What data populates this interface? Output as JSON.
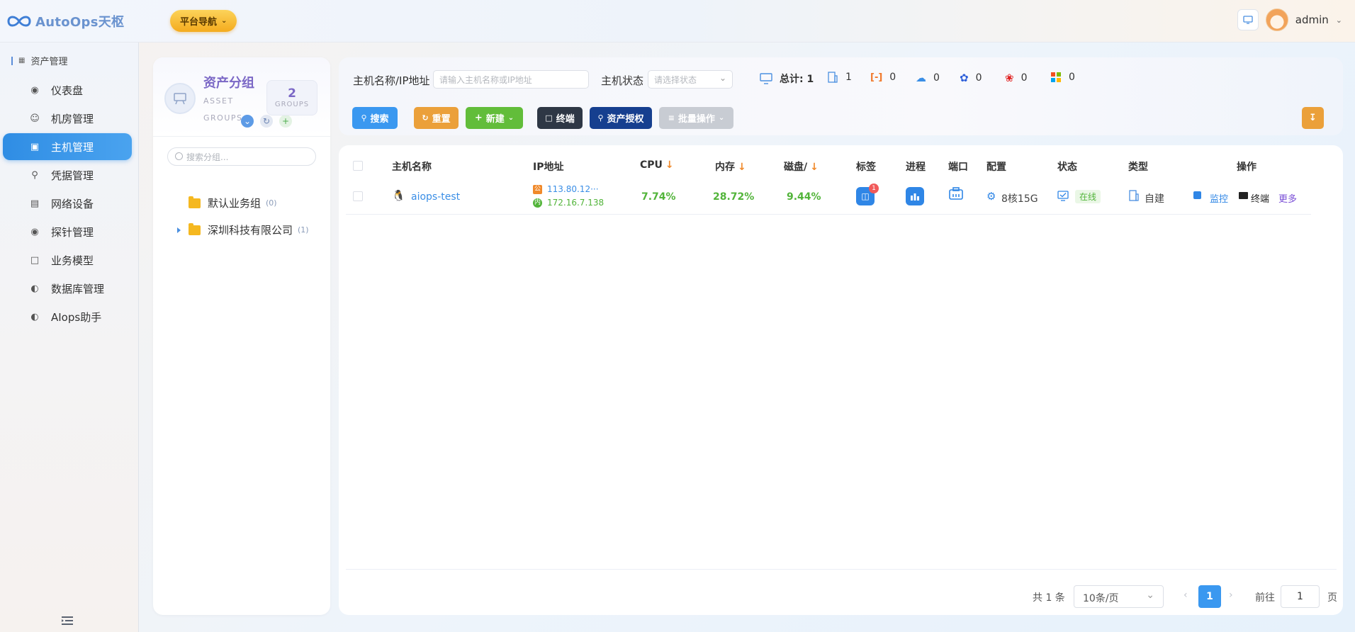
{
  "app": {
    "title": "AutoOps天枢",
    "nav_button": "平台导航",
    "user": "admin"
  },
  "colors": {
    "brand": "#2f8de4",
    "accent_orange": "#f0892a",
    "success": "#52b43a",
    "nav_gold": "#f4ab1e"
  },
  "sidebar": {
    "section": "资产管理",
    "items": [
      {
        "label": "仪表盘",
        "icon": "camera-icon"
      },
      {
        "label": "机房管理",
        "icon": "user-icon"
      },
      {
        "label": "主机管理",
        "icon": "monitor-icon",
        "active": true
      },
      {
        "label": "凭据管理",
        "icon": "key-icon"
      },
      {
        "label": "网络设备",
        "icon": "router-icon"
      },
      {
        "label": "探针管理",
        "icon": "camera-icon"
      },
      {
        "label": "业务模型",
        "icon": "folder-icon"
      },
      {
        "label": "数据库管理",
        "icon": "gauge-icon"
      },
      {
        "label": "AIops助手",
        "icon": "gauge-icon"
      }
    ]
  },
  "groups": {
    "title": "资产分组",
    "sub1": "ASSET",
    "sub2": "GROUPS",
    "count": "2",
    "count_caption": "GROUPS",
    "search_placeholder": "搜索分组...",
    "tree": [
      {
        "name": "默认业务组",
        "count": "(0)"
      },
      {
        "name": "深圳科技有限公司",
        "count": "(1)"
      }
    ]
  },
  "filters": {
    "host_label": "主机名称/IP地址",
    "host_placeholder": "请输入主机名称或IP地址",
    "status_label": "主机状态",
    "status_placeholder": "请选择状态"
  },
  "stats": {
    "total_label": "总计: 1",
    "building": "1",
    "aliyun": "0",
    "tencent": "0",
    "baidu": "0",
    "huawei": "0",
    "windows": "0"
  },
  "toolbar": {
    "search": "搜索",
    "reset": "重置",
    "new": "新建",
    "terminal": "终端",
    "authorize": "资产授权",
    "batch": "批量操作"
  },
  "table": {
    "headers": {
      "name": "主机名称",
      "ip": "IP地址",
      "cpu": "CPU",
      "mem": "内存",
      "disk": "磁盘/",
      "tag": "标签",
      "process": "进程",
      "port": "端口",
      "config": "配置",
      "status": "状态",
      "type": "类型",
      "ops": "操作"
    },
    "rows": [
      {
        "name": "aiops-test",
        "ip_public": "113.80.12···",
        "ip_private": "172.16.7.138",
        "ip_public_badge": "公",
        "ip_private_badge": "内",
        "cpu": "7.74%",
        "mem": "28.72%",
        "disk": "9.44%",
        "tag_count": "1",
        "config": "8核15G",
        "status": "在线",
        "type": "自建",
        "op_monitor": "监控",
        "op_terminal": "终端",
        "op_more": "更多"
      }
    ]
  },
  "pager": {
    "total": "共 1 条",
    "page_size": "10条/页",
    "current": "1",
    "goto_label": "前往",
    "goto_value": "1",
    "page_suffix": "页"
  }
}
